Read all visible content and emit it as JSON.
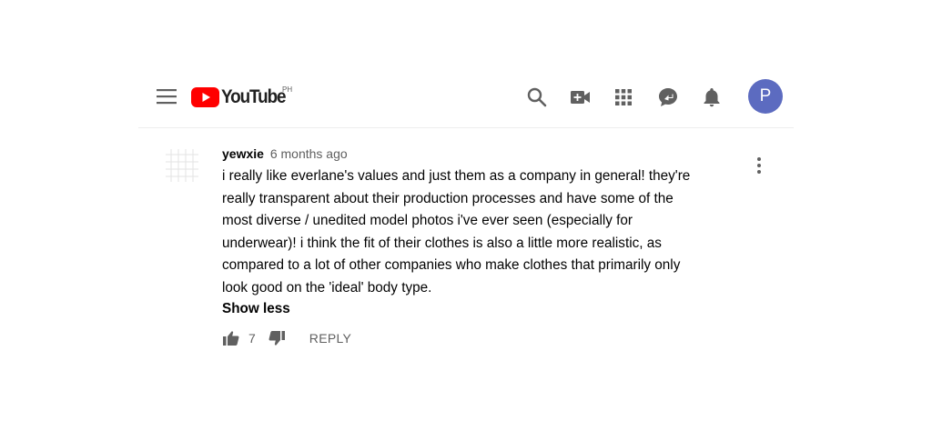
{
  "header": {
    "logo_text": "YouTube",
    "region": "PH",
    "avatar_letter": "P",
    "avatar_color": "#5c6bc0",
    "brand_color": "#ff0000",
    "icons": [
      "menu-icon",
      "search-icon",
      "create-video-icon",
      "apps-grid-icon",
      "messages-icon",
      "notifications-bell-icon"
    ]
  },
  "comment": {
    "author": "yewxie",
    "time": "6 months ago",
    "lines": [
      "i really like everlane's values and just them as a company in general! they're",
      "really transparent about their production processes and have some of the",
      "most diverse / unedited model photos i've ever seen (especially for",
      "underwear)! i think the fit of their clothes is also a little more realistic, as",
      "compared to a lot of other companies who make clothes that primarily only",
      "look good on the 'ideal' body type."
    ],
    "show_less": "Show less",
    "likes": "7",
    "reply_label": "REPLY"
  }
}
